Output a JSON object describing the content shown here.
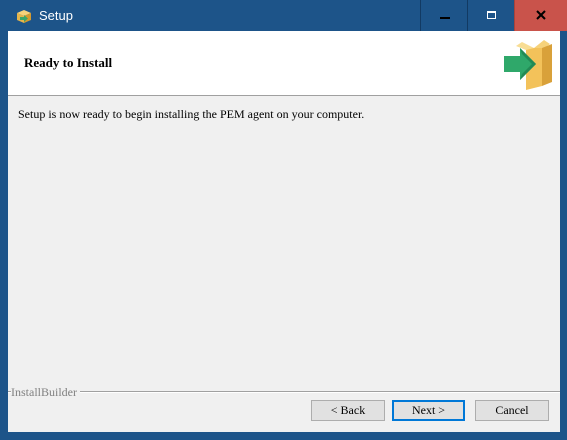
{
  "window": {
    "title": "Setup",
    "app_icon": "installer-box-icon",
    "controls": {
      "minimize_icon": "minimize-icon",
      "maximize_icon": "maximize-icon",
      "close_icon": "close-icon"
    },
    "colors": {
      "titlebar": "#1d5489",
      "close_button": "#c9534b"
    }
  },
  "header": {
    "title": "Ready to Install",
    "graphic_icon": "install-arrow-box-icon"
  },
  "body": {
    "message": "Setup is now ready to begin installing the PEM agent on your computer."
  },
  "footer": {
    "brand": "InstallBuilder",
    "buttons": {
      "back": "< Back",
      "next": "Next >",
      "cancel": "Cancel"
    }
  }
}
